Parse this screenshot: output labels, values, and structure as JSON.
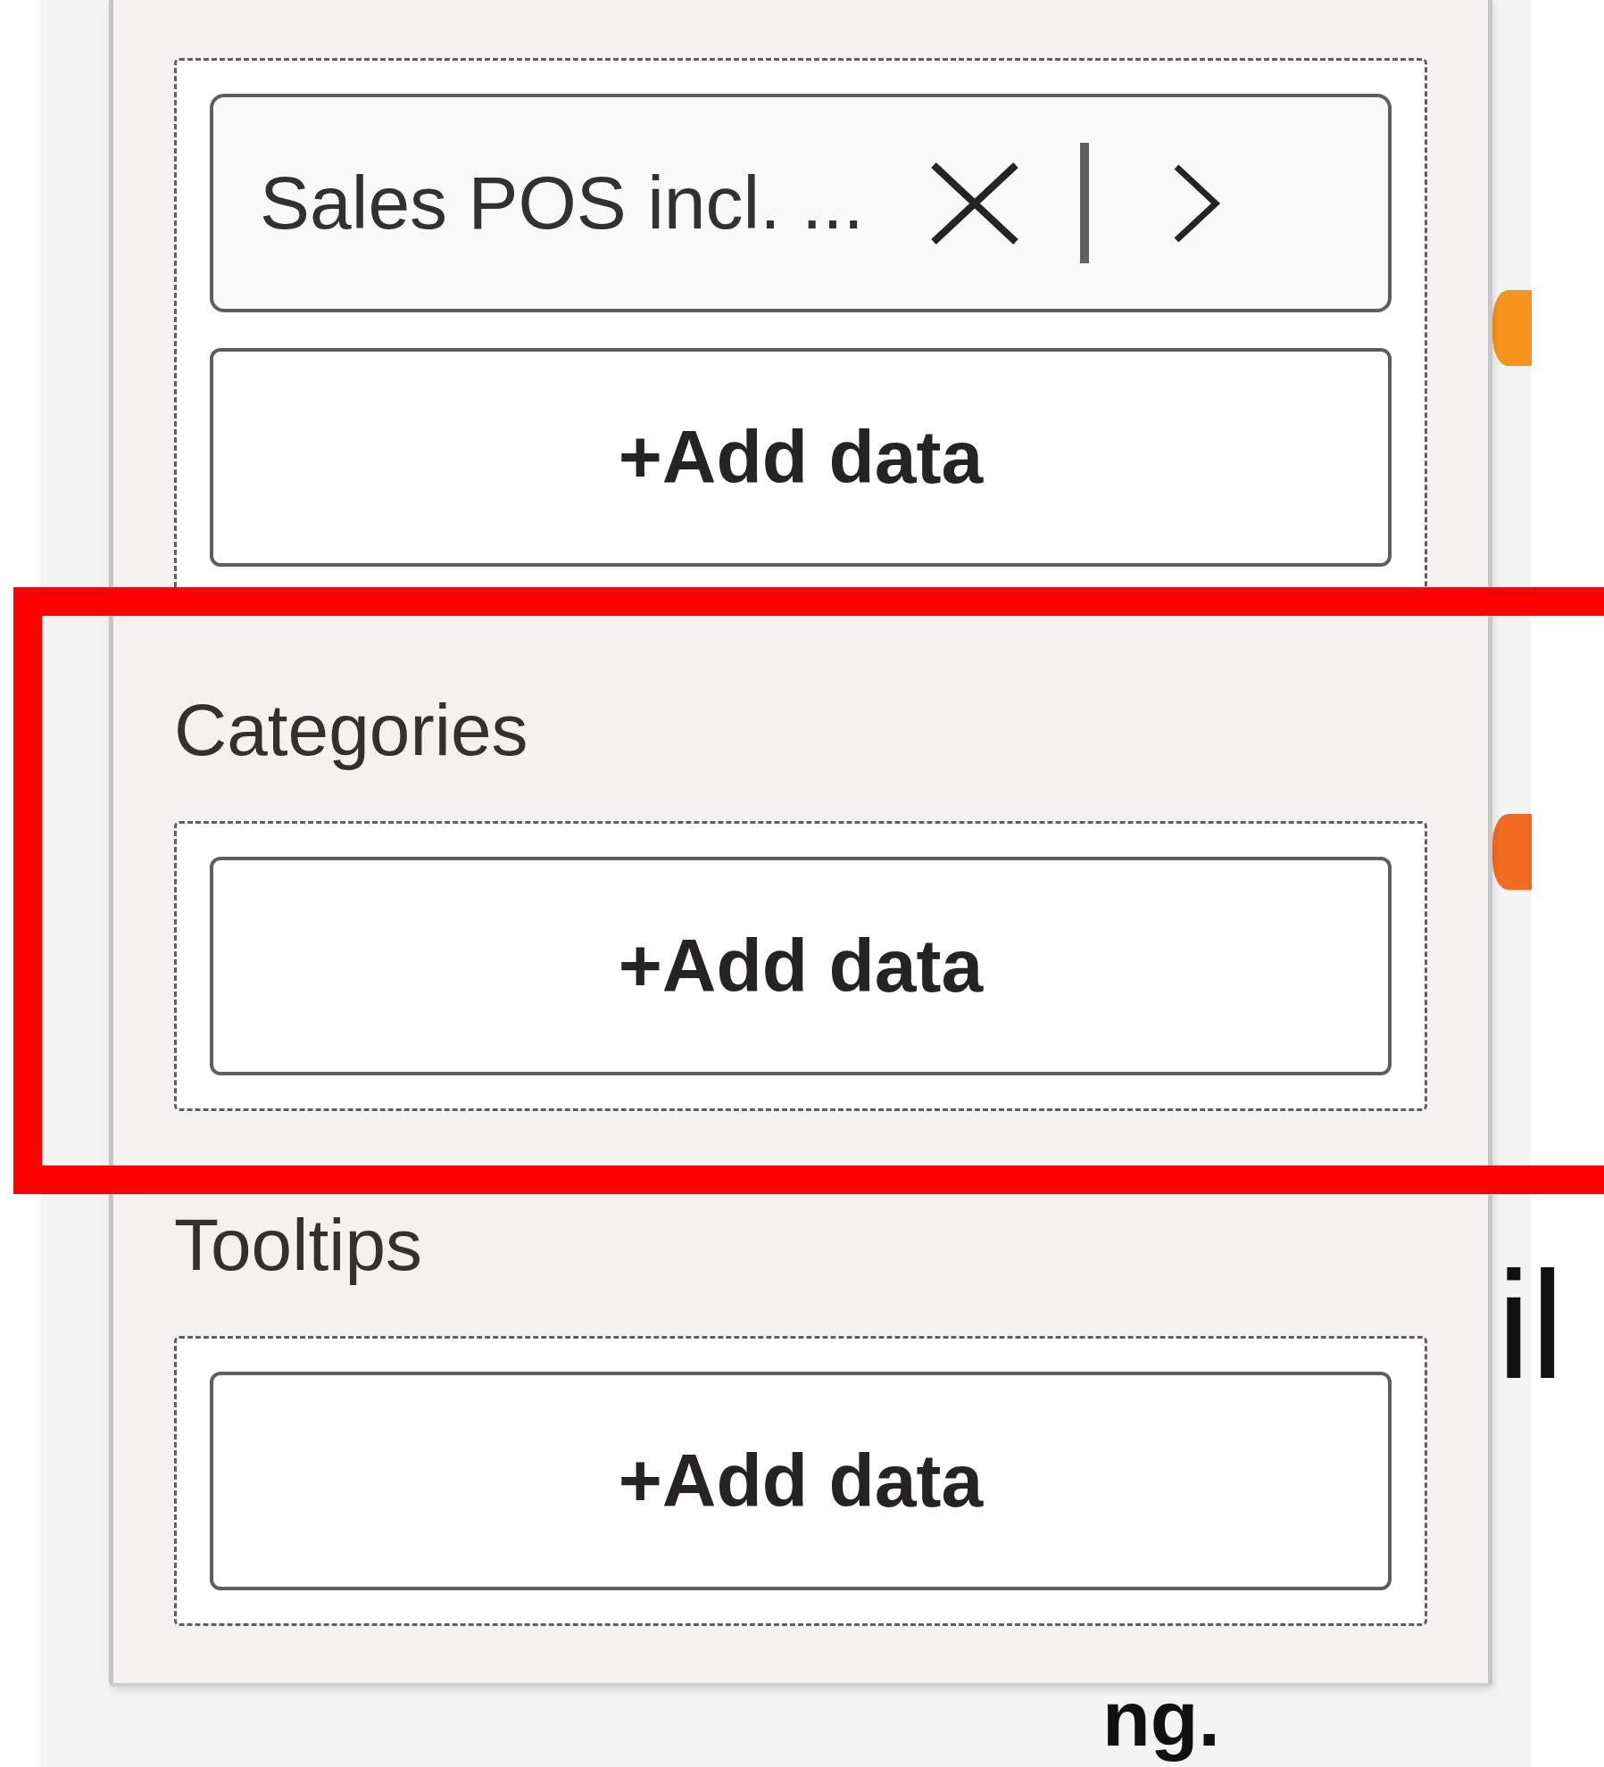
{
  "wells": [
    {
      "fields": [
        {
          "name": "Sales POS incl. ..."
        }
      ],
      "add_button": "+Add data",
      "highlighted": false
    },
    {
      "label": "Categories",
      "add_button": "+Add data",
      "highlighted": true
    },
    {
      "label": "Tooltips",
      "add_button": "+Add data",
      "highlighted": false
    }
  ],
  "background_text": [
    "il",
    "ng."
  ]
}
